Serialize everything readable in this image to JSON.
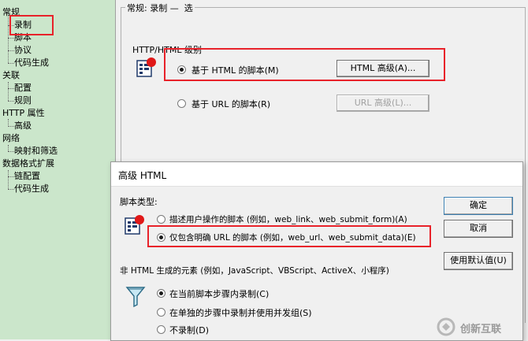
{
  "tree": {
    "nodes": [
      {
        "label": "常规"
      },
      {
        "label": "录制"
      },
      {
        "label": "脚本"
      },
      {
        "label": "协议"
      },
      {
        "label": "代码生成"
      },
      {
        "label": "关联"
      },
      {
        "label": "配置"
      },
      {
        "label": "规则"
      },
      {
        "label": "HTTP 属性"
      },
      {
        "label": "高级"
      },
      {
        "label": "网络"
      },
      {
        "label": "映射和筛选"
      },
      {
        "label": "数据格式扩展"
      },
      {
        "label": "链配置"
      },
      {
        "label": "代码生成"
      }
    ]
  },
  "main": {
    "header": "常规: 录制",
    "header_suffix": "选",
    "group_label": "HTTP/HTML 级别",
    "option_html": "基于 HTML 的脚本(M)",
    "option_html_selected": true,
    "btn_html_advanced": "HTML 高级(A)...",
    "option_url": "基于 URL 的脚本(R)",
    "option_url_selected": false,
    "btn_url_advanced": "URL 高级(L)..."
  },
  "dialog": {
    "title": "高级 HTML",
    "script_type_label": "脚本类型:",
    "opt_describe": "描述用户操作的脚本 (例如，web_link、web_submit_form)(A)",
    "opt_describe_selected": false,
    "opt_explicit": "仅包含明确 URL 的脚本 (例如，web_url、web_submit_data)(E)",
    "opt_explicit_selected": true,
    "non_html_label": "非 HTML 生成的元素 (例如，JavaScript、VBScript、ActiveX、小程序)",
    "opt_record_current": "在当前脚本步骤内录制(C)",
    "opt_record_current_selected": true,
    "opt_record_separate": "在单独的步骤中录制并使用并发组(S)",
    "opt_record_separate_selected": false,
    "opt_no_record": "不录制(D)",
    "opt_no_record_selected": false,
    "btn_ok": "确定",
    "btn_cancel": "取消",
    "btn_defaults": "使用默认值(U)"
  },
  "watermark": {
    "text": "创新互联"
  },
  "colors": {
    "highlight": "#e8222a",
    "tree_bg": "#cbe6cb"
  }
}
